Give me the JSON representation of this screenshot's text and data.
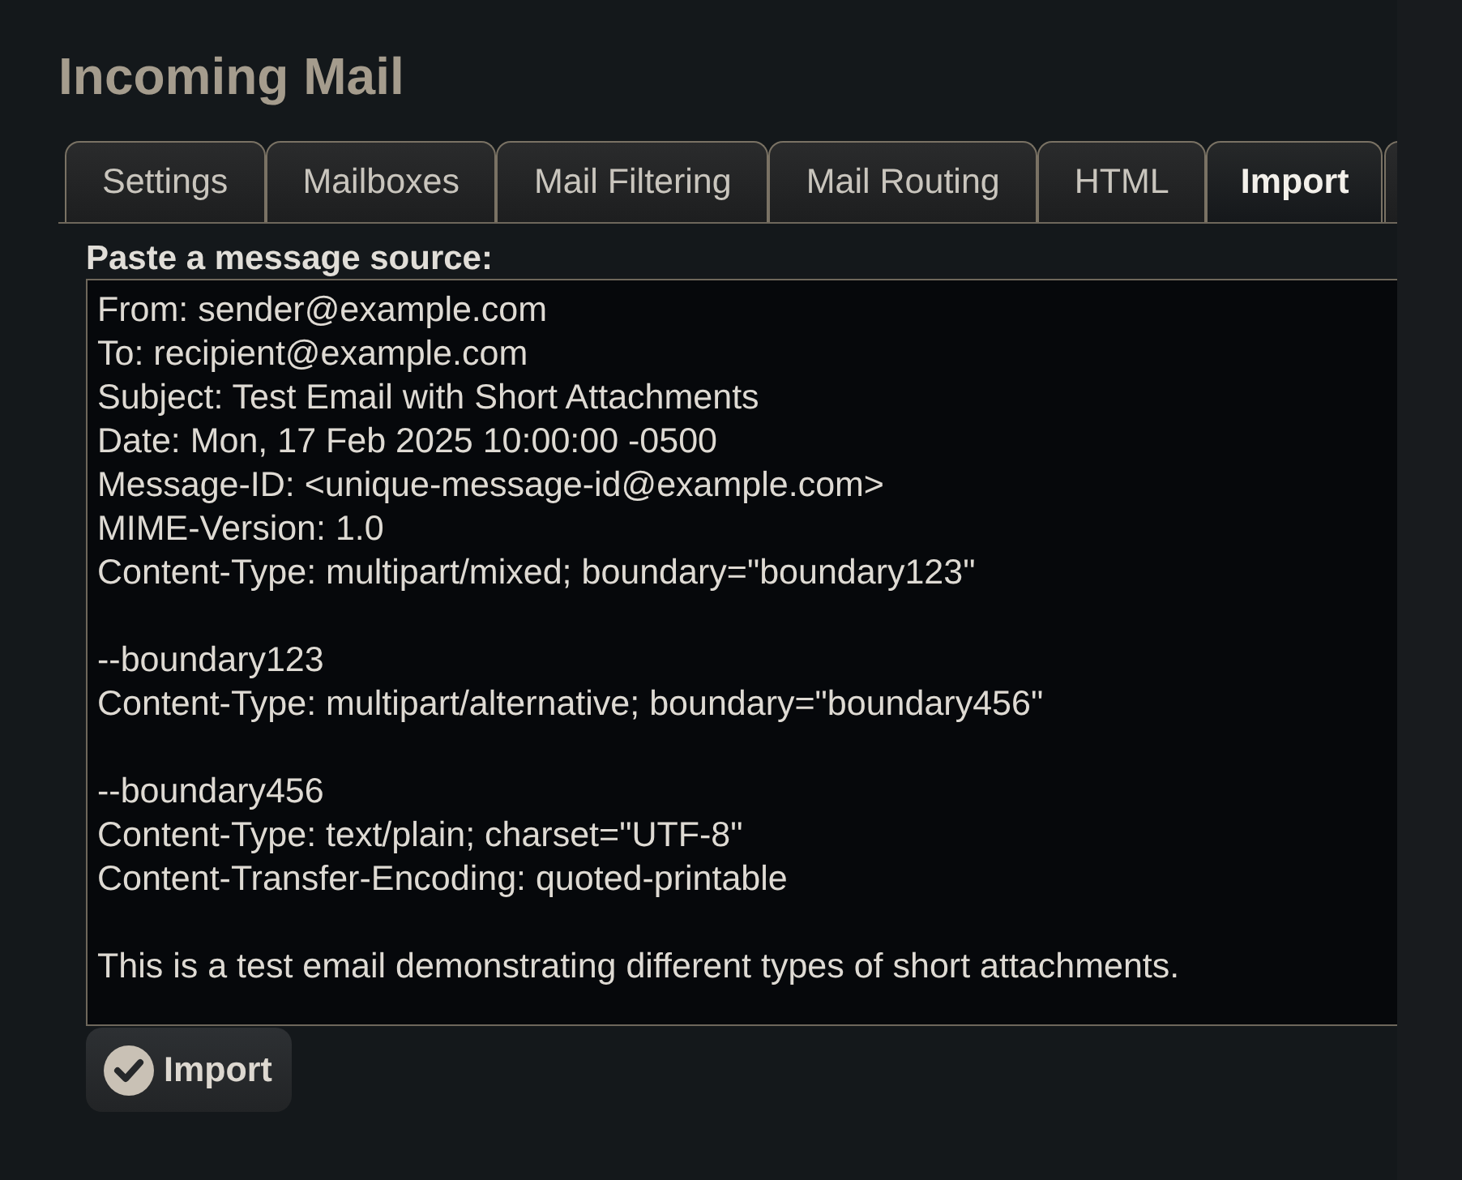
{
  "page": {
    "title": "Incoming Mail"
  },
  "tabs": [
    {
      "label": "Settings",
      "selected": false
    },
    {
      "label": "Mailboxes",
      "selected": false
    },
    {
      "label": "Mail Filtering",
      "selected": false
    },
    {
      "label": "Mail Routing",
      "selected": false
    },
    {
      "label": "HTML",
      "selected": false
    },
    {
      "label": "Import",
      "selected": true
    }
  ],
  "import_form": {
    "label": "Paste a message source:",
    "value": "From: sender@example.com\nTo: recipient@example.com\nSubject: Test Email with Short Attachments\nDate: Mon, 17 Feb 2025 10:00:00 -0500\nMessage-ID: <unique-message-id@example.com>\nMIME-Version: 1.0\nContent-Type: multipart/mixed; boundary=\"boundary123\"\n\n--boundary123\nContent-Type: multipart/alternative; boundary=\"boundary456\"\n\n--boundary456\nContent-Type: text/plain; charset=\"UTF-8\"\nContent-Transfer-Encoding: quoted-printable\n\nThis is a test email demonstrating different types of short attachments.",
    "button": "Import"
  }
}
